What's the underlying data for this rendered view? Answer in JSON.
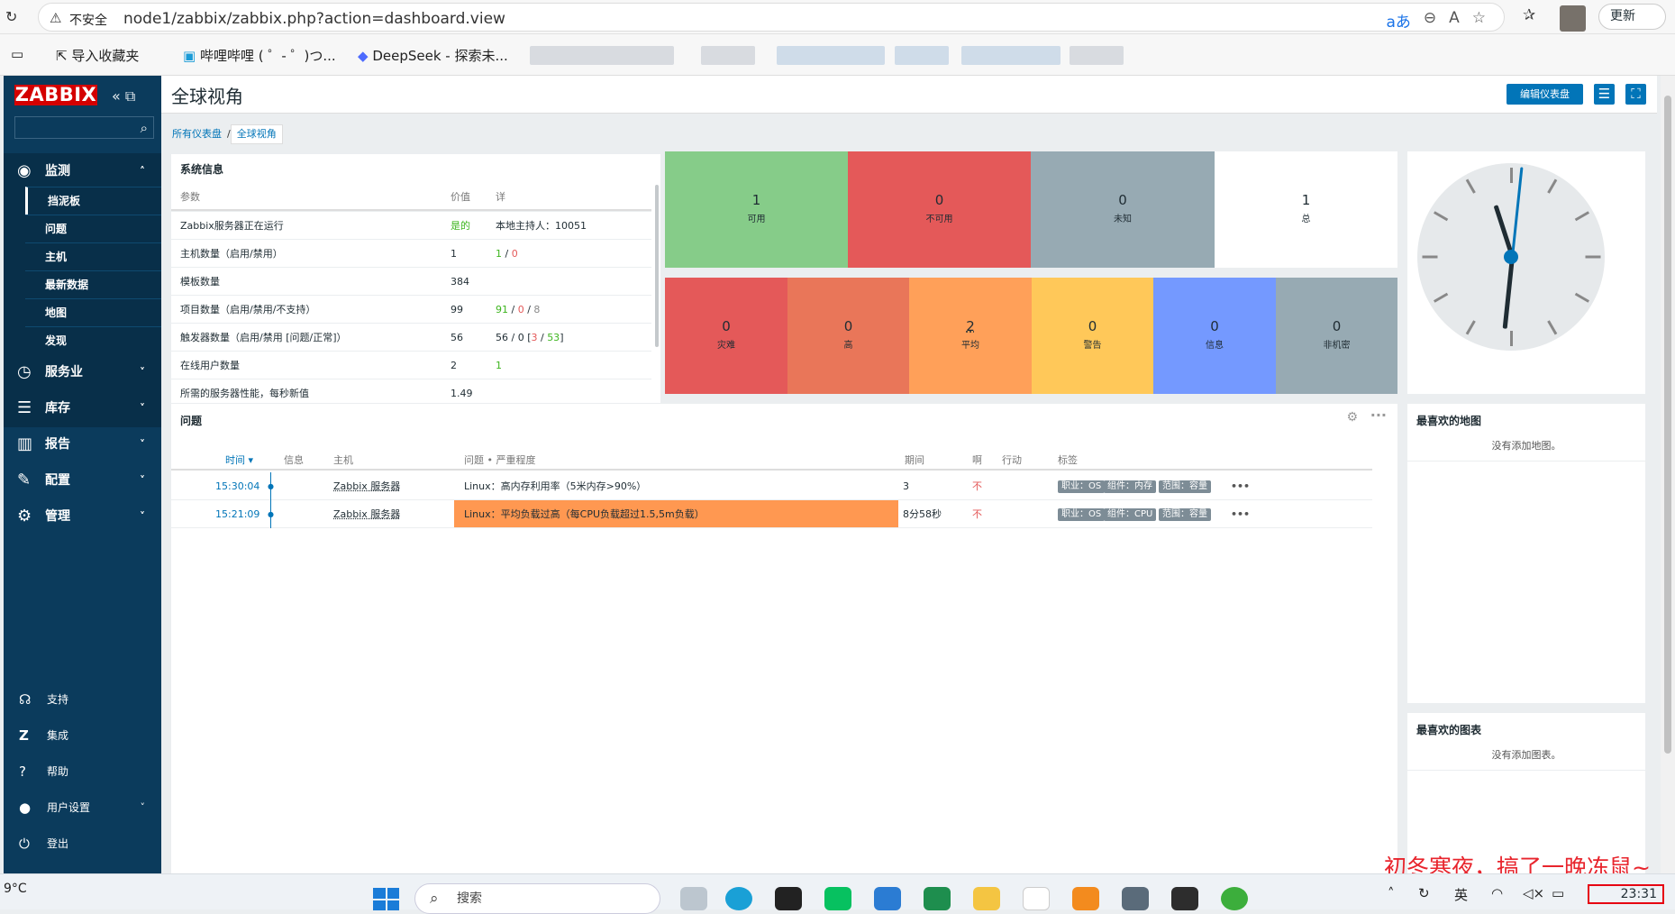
{
  "browser": {
    "security_label": "不安全",
    "url": "node1/zabbix/zabbix.php?action=dashboard.view",
    "update_label": "更新",
    "bookmarks": [
      "导入收藏夹",
      "哔哩哔哩 ( ゜- ゜)つ...",
      "DeepSeek - 探索未..."
    ]
  },
  "sidebar": {
    "logo": "ZABBIX",
    "monitoring": {
      "label": "监测",
      "items": [
        "挡泥板",
        "问题",
        "主机",
        "最新数据",
        "地图",
        "发现"
      ]
    },
    "sections": [
      "服务业",
      "库存",
      "报告",
      "配置",
      "管理"
    ],
    "footer": [
      "支持",
      "集成",
      "帮助",
      "用户设置",
      "登出"
    ]
  },
  "header": {
    "title": "全球视角",
    "edit_label": "编辑仪表盘"
  },
  "breadcrumb": [
    "所有仪表盘",
    "全球视角"
  ],
  "system_info": {
    "title": "系统信息",
    "columns": [
      "参数",
      "价值",
      "详"
    ],
    "rows": [
      {
        "param": "Zabbix服务器正在运行",
        "value": "是的",
        "detail": "本地主持人：10051"
      },
      {
        "param": "主机数量（启用/禁用）",
        "value": "1",
        "detail_parts": [
          "1",
          " / ",
          "0"
        ]
      },
      {
        "param": "模板数量",
        "value": "384",
        "detail": ""
      },
      {
        "param": "项目数量（启用/禁用/不支持）",
        "value": "99",
        "detail_parts": [
          "91",
          " / ",
          "0",
          " / ",
          "8"
        ]
      },
      {
        "param": "触发器数量（启用/禁用 [问题/正常]）",
        "value": "56",
        "detail_parts": [
          "56 / 0 [",
          "3",
          " / ",
          "53",
          "]"
        ]
      },
      {
        "param": "在线用户数量",
        "value": "2",
        "detail": "1"
      },
      {
        "param": "所需的服务器性能，每秒新值",
        "value": "1.49",
        "detail": ""
      }
    ]
  },
  "host_availability": [
    {
      "count": "1",
      "label": "可用",
      "color": "#86cc89"
    },
    {
      "count": "0",
      "label": "不可用",
      "color": "#e45959"
    },
    {
      "count": "0",
      "label": "未知",
      "color": "#97aab3"
    },
    {
      "count": "1",
      "label": "总",
      "color": "#ffffff"
    }
  ],
  "severity": [
    {
      "count": "0",
      "label": "灾难",
      "color": "#e45959"
    },
    {
      "count": "0",
      "label": "高",
      "color": "#e97659"
    },
    {
      "count": "2",
      "label": "平均",
      "color": "#ffa059"
    },
    {
      "count": "0",
      "label": "警告",
      "color": "#ffc859"
    },
    {
      "count": "0",
      "label": "信息",
      "color": "#7499ff"
    },
    {
      "count": "0",
      "label": "非机密",
      "color": "#97aab3"
    }
  ],
  "problems": {
    "title": "问题",
    "columns": [
      "时间 ▾",
      "信息",
      "主机",
      "问题 • 严重程度",
      "期间",
      "啊",
      "行动",
      "标签"
    ],
    "rows": [
      {
        "time": "15:30:04",
        "host": "Zabbix 服务器",
        "problem": "Linux：高内存利用率（5米内存>90%）",
        "duration": "3",
        "ack": "不",
        "tags": [
          "职业：OS",
          "组件：内存",
          "范围：容量"
        ]
      },
      {
        "time": "15:21:09",
        "host": "Zabbix 服务器",
        "problem": "Linux：平均负载过高（每CPU负载超过1.5,5m负载）",
        "duration": "8分58秒",
        "ack": "不",
        "tags": [
          "职业：OS",
          "组件：CPU",
          "范围：容量"
        ]
      }
    ]
  },
  "fav_maps": {
    "title": "最喜欢的地图",
    "empty": "没有添加地图。"
  },
  "fav_graphs": {
    "title": "最喜欢的图表",
    "empty": "没有添加图表。"
  },
  "taskbar": {
    "weather": "9°C",
    "search": "搜索",
    "ime": "英",
    "time": "23:31",
    "overlay": "初冬寒夜，搞了一晚冻鼠~"
  }
}
